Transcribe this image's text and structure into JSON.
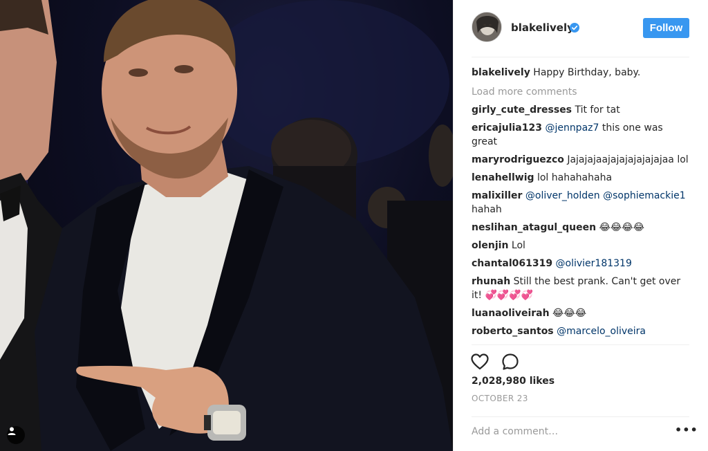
{
  "photo": {
    "description_icon": "person-icon"
  },
  "header": {
    "username": "blakelively",
    "verified_icon": "verified-badge-icon",
    "follow_label": "Follow",
    "accent": "#3897f0"
  },
  "caption": {
    "user": "blakelively",
    "text": "Happy Birthday, baby."
  },
  "load_more": "Load more comments",
  "comments": [
    {
      "user": "girly_cute_dresses",
      "parts": [
        {
          "t": " Tit for tat"
        }
      ]
    },
    {
      "user": "ericajulia123",
      "parts": [
        {
          "t": " "
        },
        {
          "m": "@jennpaz7"
        },
        {
          "t": " this one was great"
        }
      ]
    },
    {
      "user": "maryrodriguezco",
      "parts": [
        {
          "t": " Jajajajaajajajajajajajaa lol"
        }
      ]
    },
    {
      "user": "lenahellwig",
      "parts": [
        {
          "t": " lol hahahahaha"
        }
      ]
    },
    {
      "user": "malixiller",
      "parts": [
        {
          "t": " "
        },
        {
          "m": "@oliver_holden"
        },
        {
          "t": " "
        },
        {
          "m": "@sophiemackie1"
        },
        {
          "t": " hahah"
        }
      ]
    },
    {
      "user": "neslihan_atagul_queen",
      "parts": [
        {
          "t": " 😂😂😂😂"
        }
      ]
    },
    {
      "user": "olenjin",
      "parts": [
        {
          "t": " Lol"
        }
      ]
    },
    {
      "user": "chantal061319",
      "parts": [
        {
          "t": " "
        },
        {
          "m": "@olivier181319"
        }
      ]
    },
    {
      "user": "rhunah",
      "parts": [
        {
          "t": " Still the best prank. Can't get over it! 💞💞💞💞"
        }
      ]
    },
    {
      "user": "luanaoliveirah",
      "parts": [
        {
          "t": " 😂😂😂"
        }
      ]
    },
    {
      "user": "roberto_santos",
      "parts": [
        {
          "t": " "
        },
        {
          "m": "@marcelo_oliveira"
        }
      ]
    }
  ],
  "actions": {
    "like_icon": "heart-icon",
    "comment_icon": "comment-bubble-icon"
  },
  "likes": "2,028,980 likes",
  "date": "OCTOBER 23",
  "add_comment_placeholder": "Add a comment…",
  "more_icon": "more-options-icon"
}
